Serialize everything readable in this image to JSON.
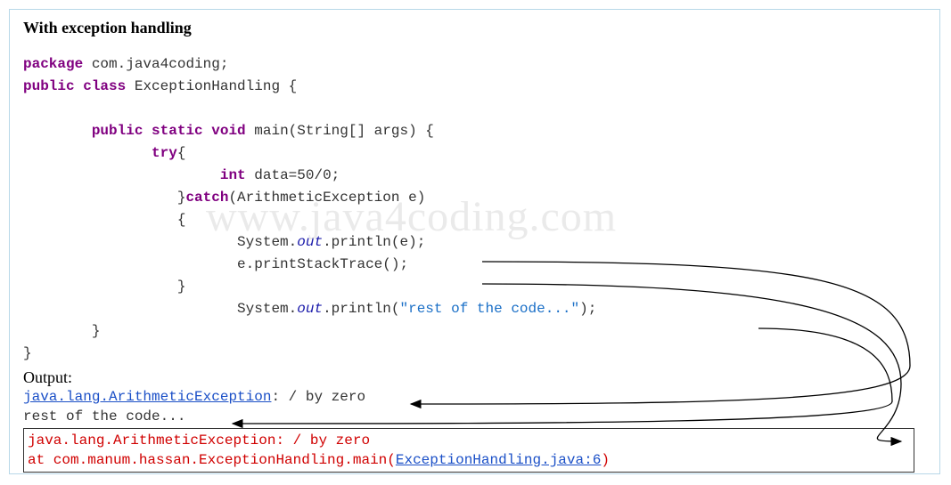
{
  "title": "With exception handling",
  "watermark": "www.java4coding.com",
  "code": {
    "kw_package": "package",
    "pkg_name": " com.java4coding;",
    "kw_public": "public",
    "kw_class": "class",
    "class_name": " ExceptionHandling {",
    "kw_static": "static",
    "kw_void": "void",
    "method_sig": " main(String[] args) {",
    "kw_try": "try",
    "try_open": "{",
    "kw_int": "int",
    "var_assign": " data=50/0;",
    "close_try": "}",
    "kw_catch": "catch",
    "catch_sig": "(ArithmeticException e)",
    "open_brace": "{",
    "system": "System.",
    "out": "out",
    "println_e": ".println(e);",
    "print_stack": "e.printStackTrace();",
    "close_brace": "}",
    "println_rest_pre": ".println(",
    "rest_str": "\"rest of the code...\"",
    "println_rest_post": ");"
  },
  "output": {
    "label": "Output:",
    "line1_link": "java.lang.ArithmeticException",
    "line1_rest": ": / by zero",
    "line2": "rest of the code...",
    "trace_line1": "java.lang.ArithmeticException: / by zero",
    "trace_line2_pre": "        at com.manum.hassan.ExceptionHandling.main(",
    "trace_line2_link": "ExceptionHandling.java:6",
    "trace_line2_post": ")"
  }
}
